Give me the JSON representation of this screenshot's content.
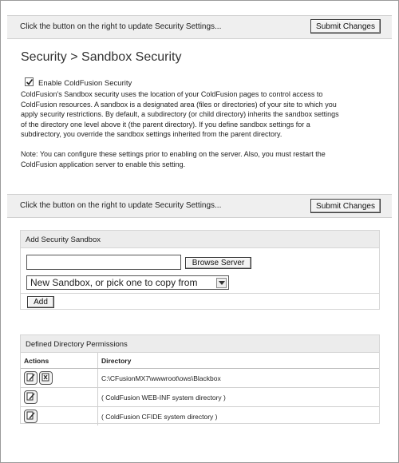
{
  "top_bar": {
    "message": "Click the button on the right to update Security Settings...",
    "submit_label": "Submit Changes"
  },
  "page_title": "Security > Sandbox Security",
  "enable_checkbox": {
    "label": "Enable ColdFusion Security",
    "checked": true
  },
  "description": [
    "ColdFusion's Sandbox security uses the location of your ColdFusion pages to control access to",
    "ColdFusion resources. A sandbox is a designated area (files or directories) of your site to which you",
    "apply security restrictions. By default, a subdirectory (or child directory) inherits the sandbox settings",
    "of the directory one level above it (the parent directory). If you define sandbox settings for a",
    "subdirectory, you override the sandbox settings inherited from the parent directory."
  ],
  "note": [
    "Note: You can configure these settings prior to enabling on the server. Also, you must restart the",
    "ColdFusion application server to enable this setting."
  ],
  "bottom_bar": {
    "message": "Click the button on the right to update Security Settings...",
    "submit_label": "Submit Changes"
  },
  "add_sandbox": {
    "header": "Add Security Sandbox",
    "path_value": "",
    "browse_label": "Browse Server",
    "select_value": "New Sandbox, or pick one to copy from",
    "add_label": "Add"
  },
  "permissions": {
    "header": "Defined Directory Permissions",
    "columns": {
      "actions": "Actions",
      "directory": "Directory"
    },
    "rows": [
      {
        "directory": "C:\\CFusionMX7\\wwwroot\\ows\\Blackbox",
        "icons": [
          "edit-icon",
          "delete-icon"
        ]
      },
      {
        "directory": "( ColdFusion WEB-INF system directory )",
        "icons": [
          "edit-icon"
        ]
      },
      {
        "directory": "( ColdFusion CFIDE system directory )",
        "icons": [
          "edit-icon"
        ]
      }
    ]
  }
}
